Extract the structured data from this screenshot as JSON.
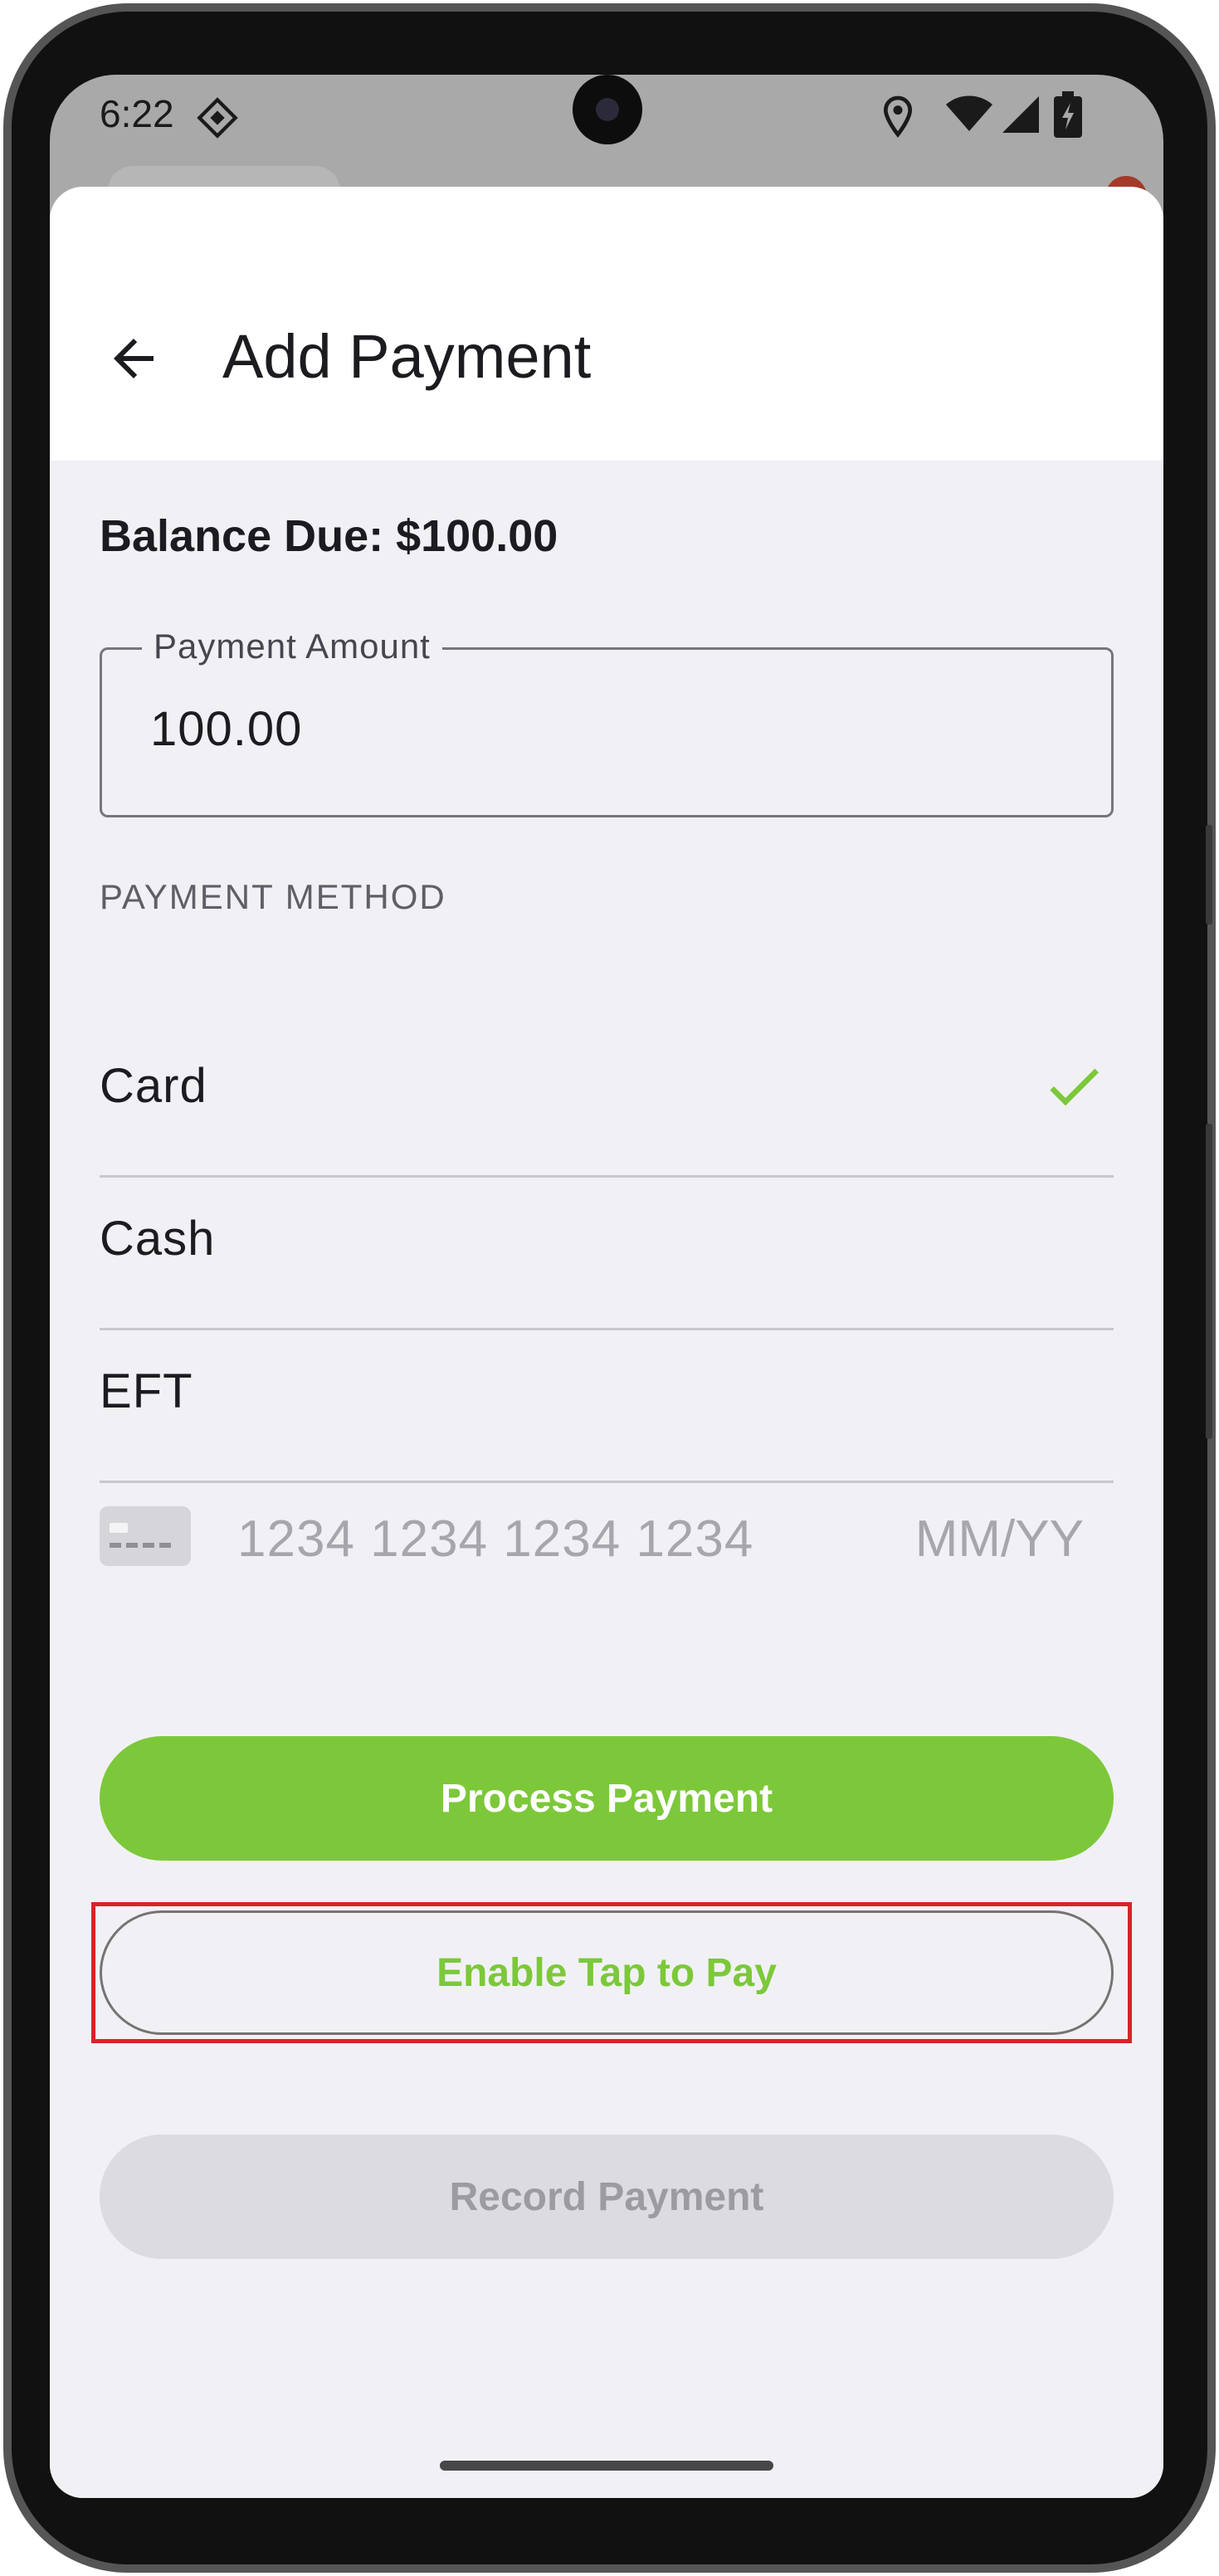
{
  "status_bar": {
    "time": "6:22"
  },
  "header": {
    "title": "Add Payment"
  },
  "balance": {
    "text": "Balance Due: $100.00"
  },
  "payment_amount": {
    "label": "Payment Amount",
    "value": "100.00"
  },
  "payment_method": {
    "header": "PAYMENT METHOD",
    "options": [
      {
        "label": "Card",
        "selected": true
      },
      {
        "label": "Cash",
        "selected": false
      },
      {
        "label": "EFT",
        "selected": false
      }
    ]
  },
  "card_input": {
    "number_placeholder": "1234 1234 1234 1234",
    "expiry_placeholder": "MM/YY"
  },
  "buttons": {
    "process": "Process Payment",
    "tap_to_pay": "Enable Tap to Pay",
    "record": "Record Payment"
  },
  "colors": {
    "accent": "#7cc83a",
    "highlight": "#d8232a"
  }
}
